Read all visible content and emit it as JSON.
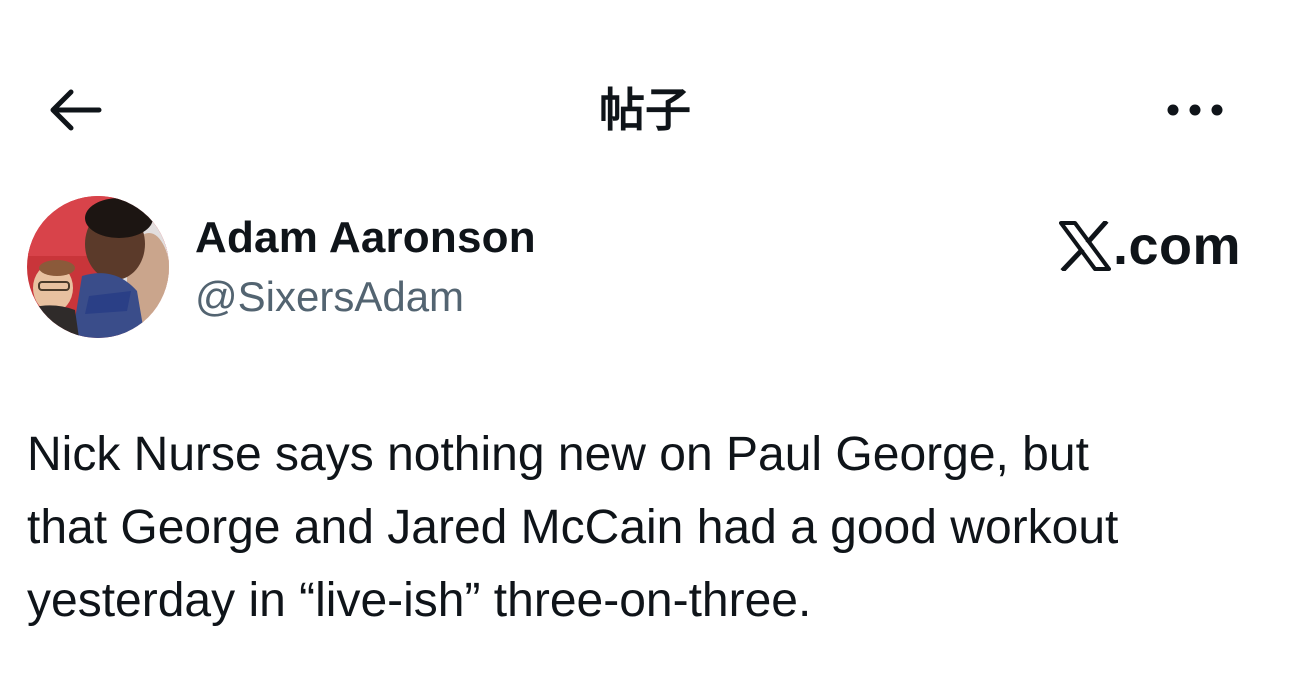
{
  "header": {
    "title": "帖子",
    "back_icon": "arrow-left-icon",
    "more_icon": "more-horizontal-icon"
  },
  "author": {
    "display_name": "Adam Aaronson",
    "handle": "@SixersAdam",
    "avatar": "avatar-photo"
  },
  "brand": {
    "label": ".com",
    "logo_icon": "x-logo-icon"
  },
  "tweet": {
    "lines": [
      "Nick Nurse says nothing new on Paul George, but",
      "that George and Jared McCain had a good workout",
      "yesterday in “live-ish” three-on-three."
    ]
  },
  "colors": {
    "text": "#0f1419",
    "secondary_text": "#536471",
    "background": "#ffffff"
  }
}
